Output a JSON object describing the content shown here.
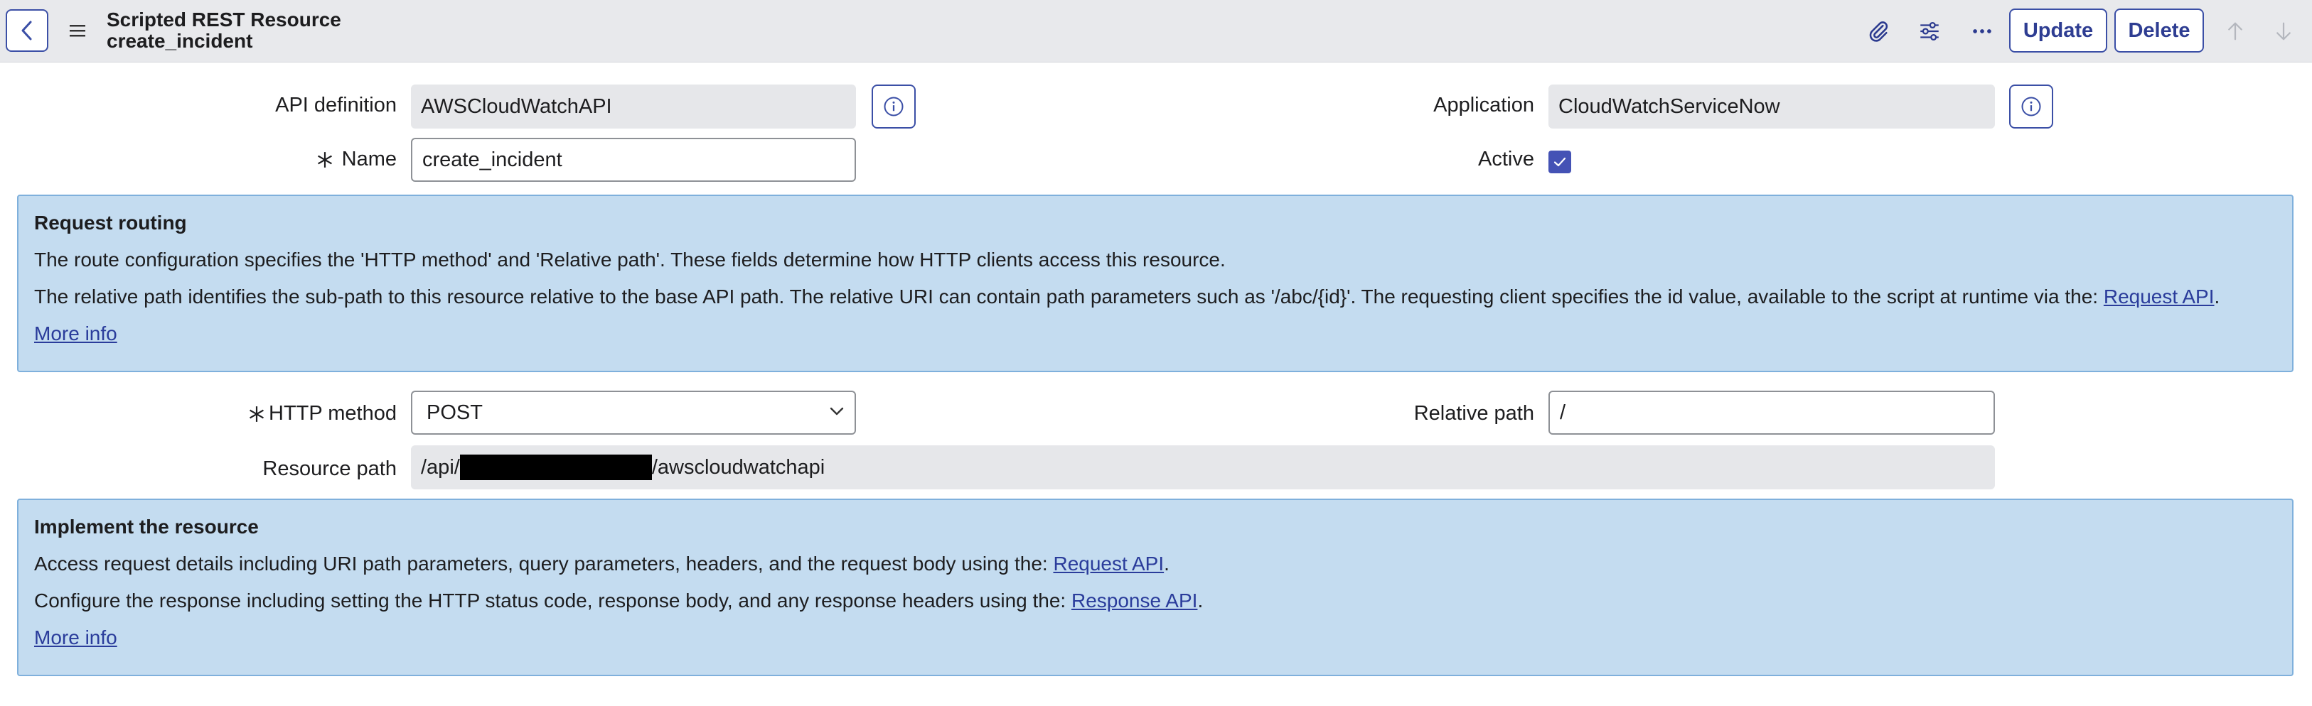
{
  "header": {
    "title": "Scripted REST Resource",
    "subtitle": "create_incident",
    "buttons": {
      "update": "Update",
      "delete": "Delete"
    },
    "icons": [
      "back-icon",
      "menu-icon",
      "attachment-icon",
      "settings-sliders-icon",
      "more-icon",
      "arrow-up-icon",
      "arrow-down-icon"
    ]
  },
  "form": {
    "api_definition": {
      "label": "API definition",
      "value": "AWSCloudWatchAPI"
    },
    "application": {
      "label": "Application",
      "value": "CloudWatchServiceNow"
    },
    "name": {
      "label": "Name",
      "value": "create_incident"
    },
    "active": {
      "label": "Active",
      "checked": true
    },
    "http_method": {
      "label": "HTTP method",
      "value": "POST"
    },
    "relative_path": {
      "label": "Relative path",
      "value": "/"
    },
    "resource_path": {
      "label": "Resource path",
      "prefix": "/api/",
      "suffix": "/awscloudwatchapi"
    }
  },
  "routing_panel": {
    "title": "Request routing",
    "line1": "The route configuration specifies the 'HTTP method' and 'Relative path'. These fields determine how HTTP clients access this resource.",
    "line2": "The relative path identifies the sub-path to this resource relative to the base API path. The relative URI can contain path parameters such as '/abc/{id}'. The requesting client specifies the id value, available to the script at runtime via the: ",
    "line2_link": "Request API",
    "line2_end": ".",
    "more": "More info"
  },
  "implement_panel": {
    "title": "Implement the resource",
    "line1": "Access request details including URI path parameters, query parameters, headers, and the request body using the: ",
    "line1_link": "Request API",
    "line1_end": ".",
    "line2": "Configure the response including setting the HTTP status code, response body, and any response headers using the: ",
    "line2_link": "Response API",
    "line2_end": ".",
    "more": "More info"
  },
  "colors": {
    "accent": "#3b4fa6",
    "panel_bg": "#c4dcf0",
    "panel_border": "#7fb0dc"
  }
}
